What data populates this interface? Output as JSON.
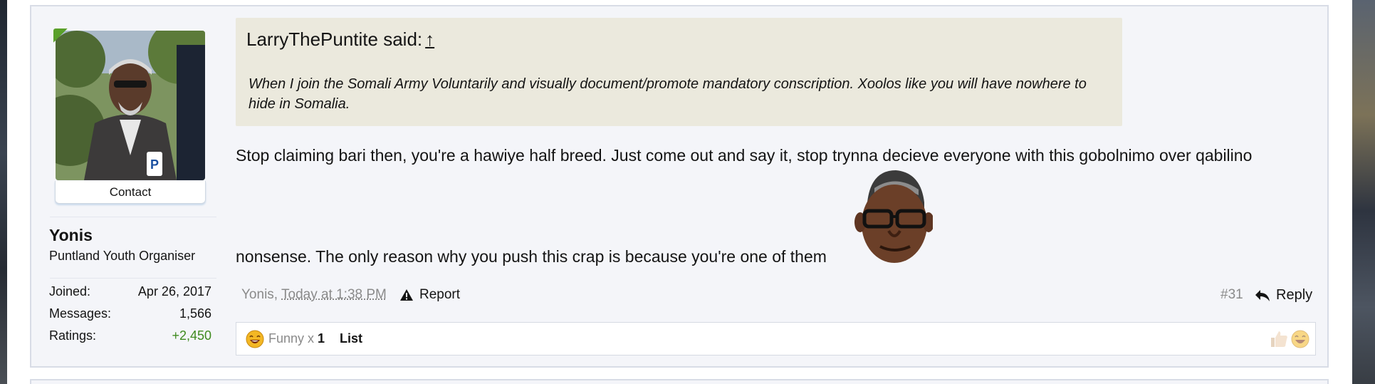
{
  "user": {
    "name": "Yonis",
    "title": "Puntland Youth Organiser",
    "contact_label": "Contact",
    "avatar_badge": "P",
    "stats": [
      {
        "label": "Joined:",
        "value": "Apr 26, 2017"
      },
      {
        "label": "Messages:",
        "value": "1,566"
      },
      {
        "label": "Ratings:",
        "value": "+2,450"
      }
    ]
  },
  "quote": {
    "author_said": "LarryThePuntite said:",
    "arrow": "↑",
    "text": "When I join the Somali Army Voluntarily and visually document/promote mandatory conscription. Xoolos like you will have nowhere to hide in Somalia."
  },
  "post": {
    "line1": "Stop claiming bari then, you're a hawiye half breed. Just come out and say it, stop trynna decieve everyone with this gobolnimo over qabilino",
    "line2": "nonsense. The only reason why you push this crap is because you're one of them"
  },
  "meta": {
    "author": "Yonis,",
    "time": "Today at 1:38 PM",
    "report_label": "Report",
    "post_number": "#31",
    "reply_label": "Reply"
  },
  "ratings": {
    "label": "Funny x",
    "count": "1",
    "list_label": "List"
  },
  "icons": {
    "warning": "warning-icon",
    "reply": "reply-arrow-icon",
    "funny": "funny-smiley-icon",
    "like": "thumbs-up-icon"
  },
  "colors": {
    "quote_bg": "#ebe9dd",
    "message_bg": "#f4f5f9",
    "positive": "#3e8a1e",
    "muted": "#8a8a8a"
  }
}
